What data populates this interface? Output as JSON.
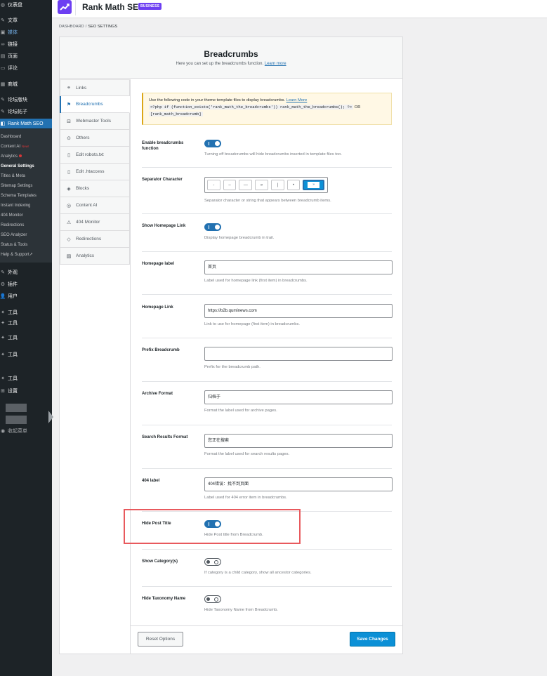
{
  "wp_menu": {
    "dashboard": "仪表盘",
    "posts": "文章",
    "media": "媒体",
    "links": "链接",
    "pages": "页面",
    "comments": "评论",
    "shop": "商城",
    "forum_sections": "论坛版块",
    "forum_topics": "论坛帖子",
    "rank_math": "Rank Math SEO",
    "appearance": "外观",
    "plugins": "插件",
    "users": "用户",
    "tools1": "工具",
    "tools2": "工具",
    "tools3": "工具",
    "tools4": "工具",
    "tools5": "工具",
    "settings": "设置",
    "collapse": "收起菜单"
  },
  "rm_submenu": {
    "dashboard": "Dashboard",
    "content_ai": "Content AI",
    "content_ai_badge": "New!",
    "analytics": "Analytics",
    "general_settings": "General Settings",
    "titles_meta": "Titles & Meta",
    "sitemap": "Sitemap Settings",
    "schema": "Schema Templates",
    "instant_indexing": "Instant Indexing",
    "monitor_404": "404 Monitor",
    "redirections": "Redirections",
    "seo_analyzer": "SEO Analyzer",
    "status_tools": "Status & Tools",
    "help_support": "Help & Support"
  },
  "header": {
    "title": "Rank Math SEO",
    "badge": "BUSINESS"
  },
  "breadcrumb": {
    "root": "DASHBOARD",
    "separator": "/",
    "current": "SEO SETTINGS"
  },
  "panel": {
    "title": "Breadcrumbs",
    "subtitle": "Here you can set up the breadcrumbs function.",
    "learn_more": "Learn more"
  },
  "tabs": [
    {
      "label": "Links",
      "icon": "link-icon"
    },
    {
      "label": "Breadcrumbs",
      "icon": "signpost-icon"
    },
    {
      "label": "Webmaster Tools",
      "icon": "toolbox-icon"
    },
    {
      "label": "Others",
      "icon": "circle-dots-icon"
    },
    {
      "label": "Edit robots.txt",
      "icon": "file-icon"
    },
    {
      "label": "Edit .htaccess",
      "icon": "file-code-icon"
    },
    {
      "label": "Blocks",
      "icon": "blocks-icon"
    },
    {
      "label": "Content AI",
      "icon": "content-ai-icon"
    },
    {
      "label": "404 Monitor",
      "icon": "warning-icon"
    },
    {
      "label": "Redirections",
      "icon": "redirect-icon"
    },
    {
      "label": "Analytics",
      "icon": "chart-icon"
    }
  ],
  "notice": {
    "text": "Use the following code in your theme template files to display breadcrumbs.",
    "learn_more": "Learn More",
    "code1": "<?php if (function_exists('rank_math_the_breadcrumbs')) rank_math_the_breadcrumbs(); ?>",
    "or": "OR",
    "code2": "[rank_math_breadcrumb]"
  },
  "fields": {
    "enable": {
      "label": "Enable breadcrumbs function",
      "desc": "Turning off breadcrumbs will hide breadcrumbs inserted in template files too.",
      "state": "on"
    },
    "separator": {
      "label": "Separator Character",
      "options": [
        "-",
        "–",
        "—",
        "»",
        "|",
        "•"
      ],
      "selected_value": "»",
      "desc": "Separator character or string that appears between breadcrumb items."
    },
    "show_home": {
      "label": "Show Homepage Link",
      "desc": "Display homepage breadcrumb in trail.",
      "state": "on"
    },
    "home_label": {
      "label": "Homepage label",
      "value": "首页",
      "desc": "Label used for homepage link (first item) in breadcrumbs."
    },
    "home_link": {
      "label": "Homepage Link",
      "value": "https://b2b.quminews.com",
      "desc": "Link to use for homepage (first item) in breadcrumbs."
    },
    "prefix": {
      "label": "Prefix Breadcrumb",
      "value": "",
      "desc": "Prefix for the breadcrumb path."
    },
    "archive_format": {
      "label": "Archive Format",
      "value": "归档于",
      "desc": "Format the label used for archive pages."
    },
    "search_format": {
      "label": "Search Results Format",
      "value": "您正在搜索",
      "desc": "Format the label used for search results pages."
    },
    "label_404": {
      "label": "404 label",
      "value": "404错误：找不到页面",
      "desc": "Label used for 404 error item in breadcrumbs."
    },
    "hide_post_title": {
      "label": "Hide Post Title",
      "desc": "Hide Post title from Breadcrumb.",
      "state": "on"
    },
    "show_category": {
      "label": "Show Category(s)",
      "desc": "If category is a child category, show all ancestor categories.",
      "state": "off"
    },
    "hide_taxonomy": {
      "label": "Hide Taxonomy Name",
      "desc": "Hide Taxonomy Name from Breadcrumb.",
      "state": "off"
    }
  },
  "footer": {
    "reset": "Reset Options",
    "save": "Save Changes"
  },
  "colors": {
    "accent": "#2271b1",
    "brand": "#6d3ff2",
    "highlight": "#e8595d"
  }
}
